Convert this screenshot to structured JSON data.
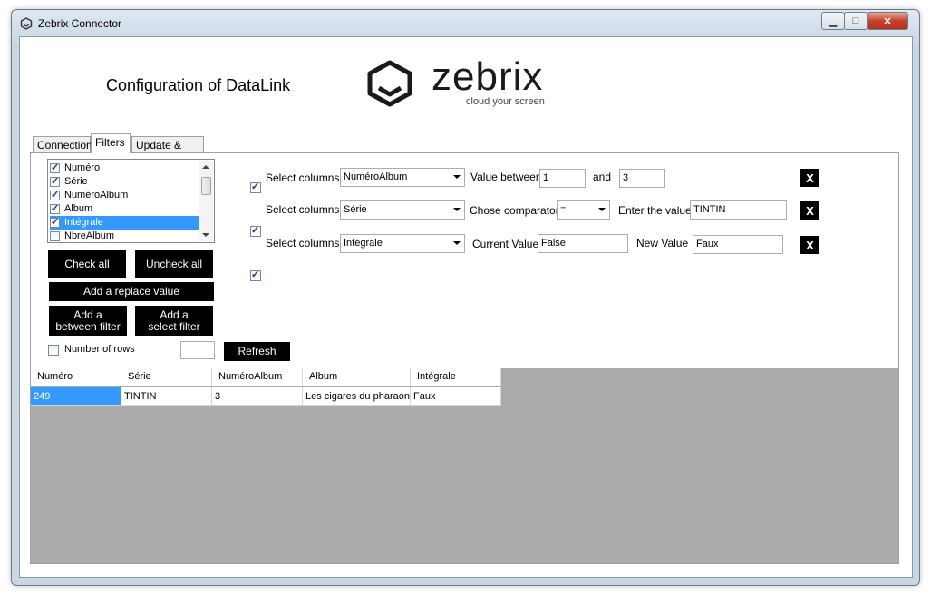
{
  "window": {
    "title": "Zebrix Connector",
    "minimize": "▁",
    "maximize": "□",
    "close": "✕"
  },
  "header": {
    "heading": "Configuration of DataLink",
    "logo_name": "zebrix",
    "logo_tagline": "cloud your screen"
  },
  "tabs": [
    {
      "label": "Connection",
      "active": false
    },
    {
      "label": "Filters",
      "active": true
    },
    {
      "label": "Update & Save",
      "active": false
    }
  ],
  "checklist": {
    "items": [
      {
        "label": "Numéro",
        "checked": true,
        "selected": false
      },
      {
        "label": "Série",
        "checked": true,
        "selected": false
      },
      {
        "label": "NuméroAlbum",
        "checked": true,
        "selected": false
      },
      {
        "label": "Album",
        "checked": true,
        "selected": false
      },
      {
        "label": "Intégrale",
        "checked": true,
        "selected": true
      },
      {
        "label": "NbreAlbum",
        "checked": false,
        "selected": false
      }
    ]
  },
  "buttons": {
    "check_all": "Check all",
    "uncheck_all": "Uncheck all",
    "add_replace": "Add a replace value",
    "add_between": "Add a between filter",
    "add_select": "Add a select filter",
    "refresh": "Refresh"
  },
  "rows_option": {
    "label": "Number of rows",
    "checked": false,
    "value": ""
  },
  "filters": [
    {
      "select_label": "Select columns",
      "column": "NuméroAlbum",
      "label_a": "Value between",
      "value_a": "1",
      "label_b": "and",
      "value_b": "3",
      "remove": "X"
    },
    {
      "select_label": "Select columns",
      "column": "Série",
      "label_a": "Chose comparator",
      "comparator": "=",
      "label_b": "Enter the value",
      "value_b": "TINTIN",
      "remove": "X"
    },
    {
      "select_label": "Select columns",
      "column": "Intégrale",
      "label_a": "Current Value",
      "value_a": "False",
      "label_b": "New Value",
      "value_b": "Faux",
      "remove": "X"
    }
  ],
  "grid": {
    "columns": [
      "Numéro",
      "Série",
      "NuméroAlbum",
      "Album",
      "Intégrale"
    ],
    "rows": [
      [
        "249",
        "TINTIN",
        "3",
        "Les cigares du pharaon",
        "Faux"
      ]
    ]
  },
  "colors": {
    "accent_black": "#000000",
    "selection_blue": "#3399ff",
    "grid_bg": "#ababab"
  }
}
